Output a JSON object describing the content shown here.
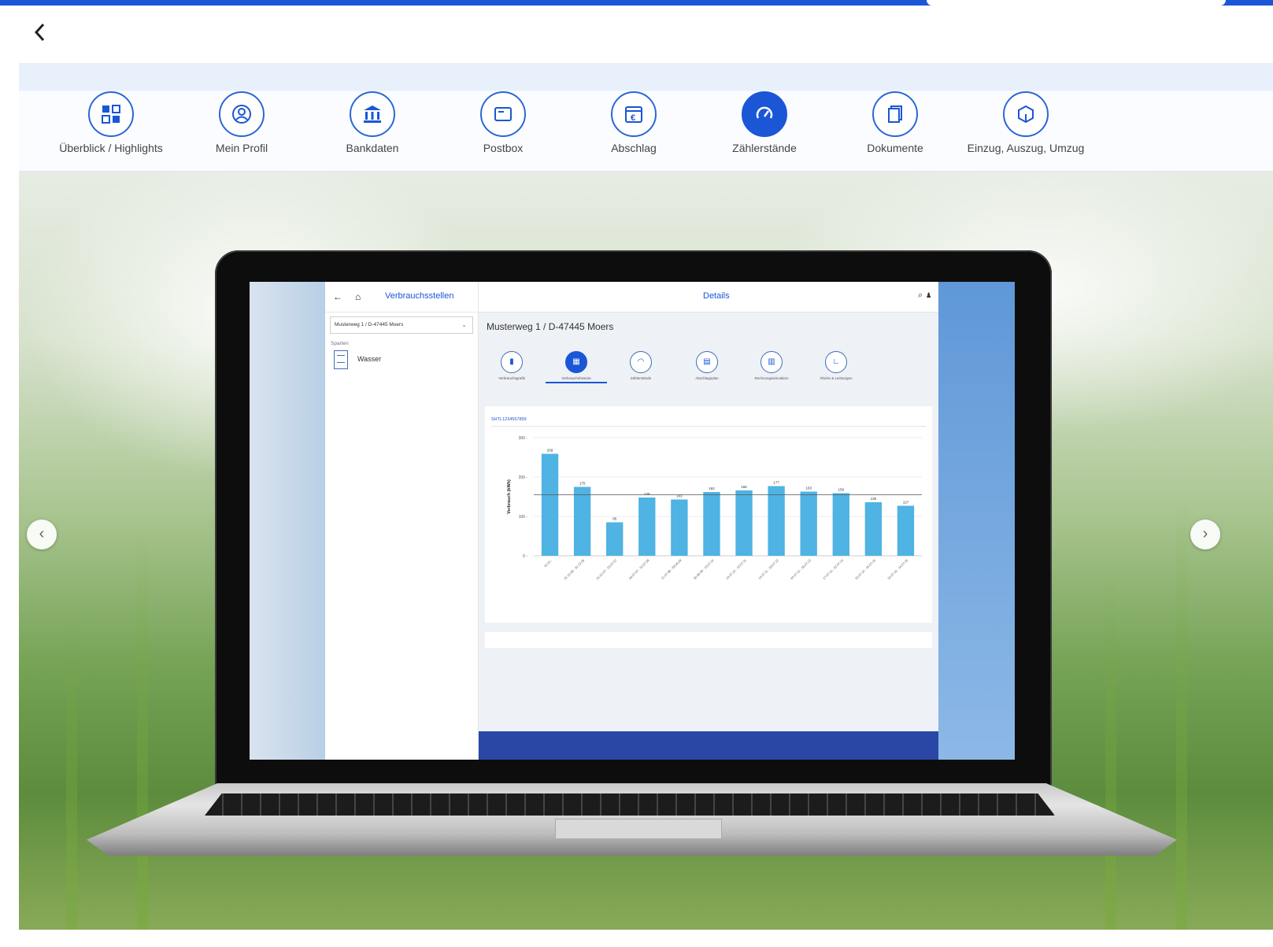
{
  "nav": {
    "items": [
      {
        "label": "Überblick / Highlights",
        "icon": "overview-icon"
      },
      {
        "label": "Mein Profil",
        "icon": "profile-icon"
      },
      {
        "label": "Bankdaten",
        "icon": "bank-icon"
      },
      {
        "label": "Postbox",
        "icon": "postbox-icon"
      },
      {
        "label": "Abschlag",
        "icon": "payment-calendar-icon"
      },
      {
        "label": "Zählerstände",
        "icon": "gauge-icon",
        "active": true
      },
      {
        "label": "Dokumente",
        "icon": "documents-icon"
      },
      {
        "label": "Einzug, Auszug, Umzug",
        "icon": "move-icon"
      }
    ]
  },
  "carousel": {
    "prev_label": "‹",
    "next_label": "›"
  },
  "inner_app": {
    "side_title": "Verbrauchsstellen",
    "address_select": "Musterweg 1 / D-47445 Moers",
    "category_label": "Sparten",
    "category_entry": "Wasser",
    "main_title": "Details",
    "address": "Musterweg 1 / D-47445 Moers",
    "meter_id": "SHTL1234567899",
    "subnav": [
      {
        "label": "Verbrauchsgrafik",
        "active": false
      },
      {
        "label": "Verbrauchshistorie",
        "active": true
      },
      {
        "label": "Zählerstände",
        "active": false
      },
      {
        "label": "Abschlagsplan",
        "active": false
      },
      {
        "label": "Rechnungssimulation",
        "active": false
      },
      {
        "label": "Fläche & Leistungen",
        "active": false
      }
    ]
  },
  "colors": {
    "accent": "#1a56d6",
    "bar": "#4fb3e3",
    "footer": "#2a47a6"
  },
  "chart_data": {
    "type": "bar",
    "ylabel": "Verbrauch (kWh)",
    "ylim": [
      0,
      300
    ],
    "yticks": [
      0,
      100,
      200,
      300
    ],
    "reference_line": 155,
    "categories": [
      "01.01.-",
      "01.10.06 - 31.12.06",
      "01.01.07 - 23.07.07",
      "24.07.07 - 10.07.08",
      "11.07.08 - 29.06.09",
      "30.06.09 - 13.07.10",
      "14.07.10 - 13.07.11",
      "14.07.11 - 23.07.12",
      "24.07.12 - 16.07.13",
      "17.07.13 - 22.07.14",
      "23.07.14 - 15.07.15",
      "16.07.15 - 14.07.16"
    ],
    "values": [
      259,
      175,
      85,
      148,
      143,
      162,
      166,
      177,
      163,
      159,
      136,
      127
    ]
  }
}
